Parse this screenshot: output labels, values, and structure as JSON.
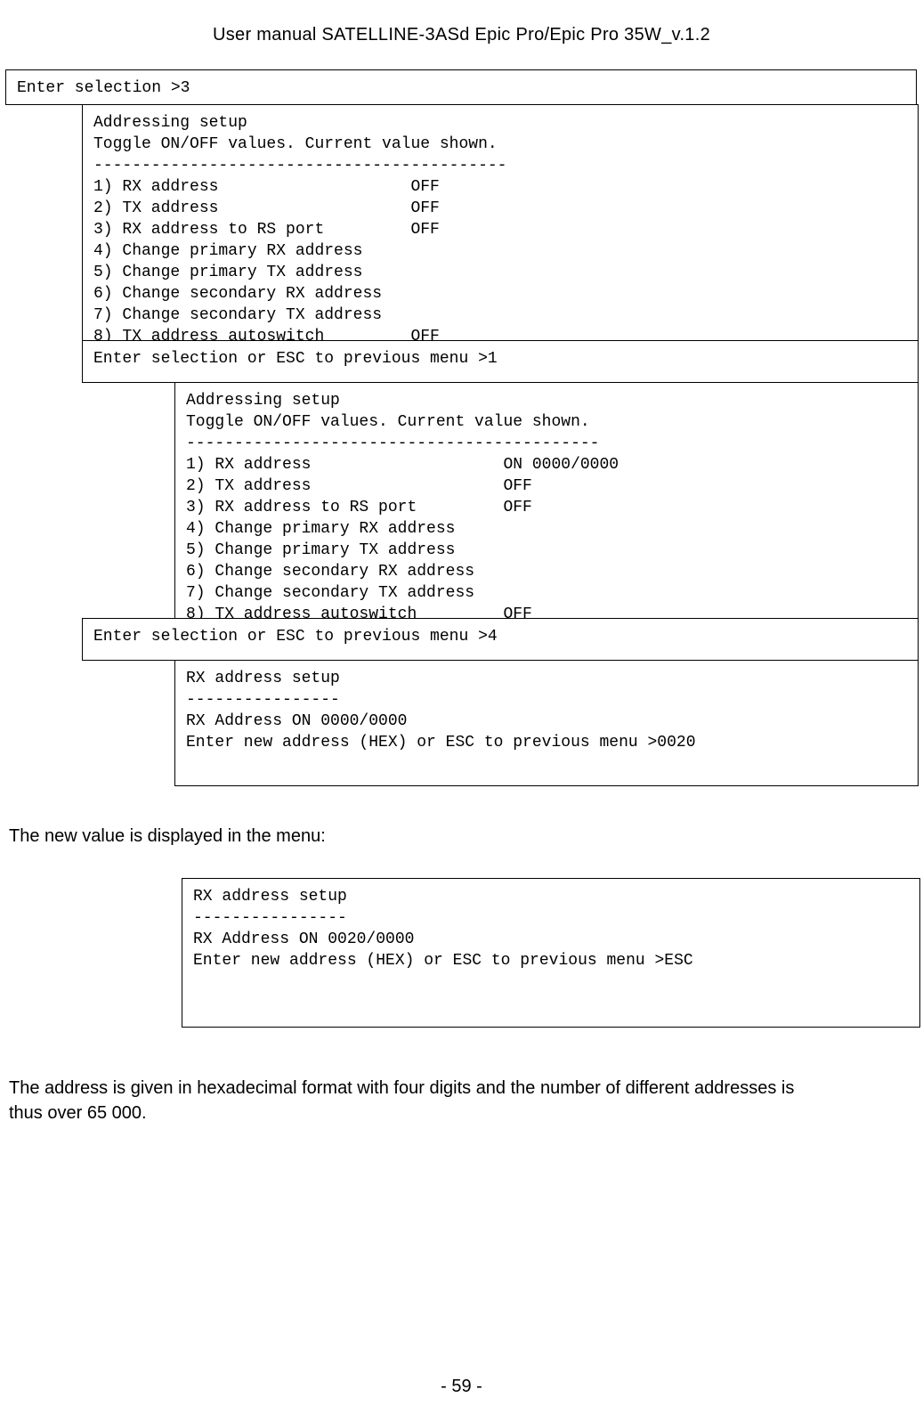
{
  "header": {
    "title": "User manual SATELLINE-3ASd Epic Pro/Epic Pro 35W_v.1.2"
  },
  "box1": {
    "prompt": "Enter selection >3"
  },
  "box2": {
    "title": "Addressing setup",
    "subtitle": "Toggle ON/OFF values. Current value shown.",
    "divider": "-------------------------------------------",
    "line1": "1) RX address                    OFF",
    "line2": "2) TX address                    OFF",
    "line3": "3) RX address to RS port         OFF",
    "line4": "4) Change primary RX address",
    "line5": "5) Change primary TX address",
    "line6": "6) Change secondary RX address",
    "line7": "7) Change secondary TX address",
    "line8": "8) TX address autoswitch         OFF"
  },
  "box3": {
    "prompt": "Enter selection or ESC to previous menu >1"
  },
  "box4": {
    "title": "Addressing setup",
    "subtitle": "Toggle ON/OFF values. Current value shown.",
    "divider": "-------------------------------------------",
    "line1": "1) RX address                    ON 0000/0000",
    "line2": "2) TX address                    OFF",
    "line3": "3) RX address to RS port         OFF",
    "line4": "4) Change primary RX address",
    "line5": "5) Change primary TX address",
    "line6": "6) Change secondary RX address",
    "line7": "7) Change secondary TX address",
    "line8": "8) TX address autoswitch         OFF"
  },
  "box5": {
    "prompt": "Enter selection or ESC to previous menu >4"
  },
  "box6": {
    "title": "RX address setup",
    "divider": "----------------",
    "line1": "RX Address ON 0000/0000",
    "blank": "",
    "line2": "Enter new address (HEX) or ESC to previous menu >0020"
  },
  "narrative1": "The new value is displayed in the menu:",
  "box7": {
    "title": "RX address setup",
    "divider": "----------------",
    "line1": "RX Address ON 0020/0000",
    "blank": "",
    "line2": "Enter new address (HEX) or ESC to previous menu >ESC"
  },
  "narrative2": "The address is given in hexadecimal format with four digits and the number of different addresses is thus over 65 000.",
  "footer": {
    "page_number": "- 59 -"
  }
}
